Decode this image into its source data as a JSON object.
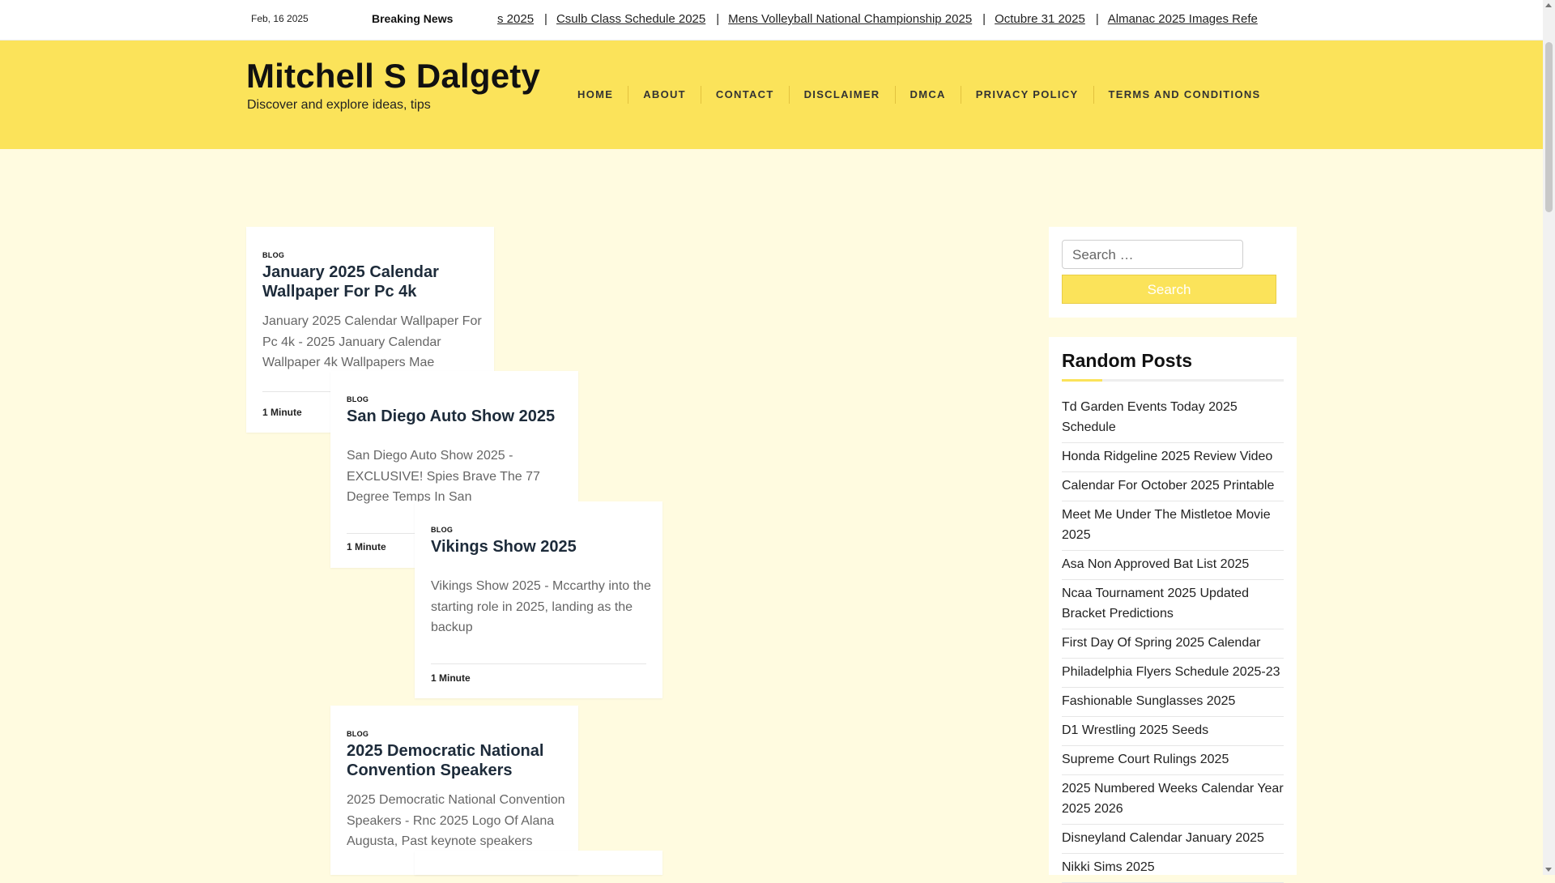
{
  "topbar": {
    "date": "Feb, 16 2025",
    "breaking_label": "Breaking News",
    "ticker": [
      "s 2025",
      "Csulb Class Schedule 2025",
      "Mens Volleyball National Championship 2025",
      "Octubre 31 2025",
      "Almanac 2025 Images Refe"
    ]
  },
  "header": {
    "site_title": "Mitchell S Dalgety",
    "tagline": "Discover and explore ideas, tips",
    "nav": [
      "HOME",
      "ABOUT",
      "CONTACT",
      "DISCLAIMER",
      "DMCA",
      "PRIVACY POLICY",
      "TERMS AND CONDITIONS"
    ]
  },
  "posts": [
    {
      "category": "BLOG",
      "title": "January 2025 Calendar Wallpaper For Pc 4k",
      "excerpt": "January 2025 Calendar Wallpaper For Pc 4k - 2025 January Calendar Wallpaper 4k Wallpapers Mae",
      "read_time": "1 Minute"
    },
    {
      "category": "BLOG",
      "title": "San Diego Auto Show 2025",
      "excerpt": "San Diego Auto Show 2025 - EXCLUSIVE! Spies Brave The 77 Degree Temps In San",
      "read_time": "1 Minute"
    },
    {
      "category": "BLOG",
      "title": "Vikings Show 2025",
      "excerpt": "Vikings Show 2025 - Mccarthy into the starting role in 2025, landing as the backup",
      "read_time": "1 Minute"
    },
    {
      "category": "BLOG",
      "title": "2025 Democratic National Convention Speakers",
      "excerpt": "2025 Democratic National Convention Speakers - Rnc 2025 Logo Of Alana Augusta, Past keynote speakers",
      "read_time": ""
    }
  ],
  "sidebar": {
    "search": {
      "placeholder": "Search …",
      "button_label": "Search"
    },
    "random_posts": {
      "title": "Random Posts",
      "items": [
        "Td Garden Events Today 2025 Schedule",
        "Honda Ridgeline 2025 Review Video",
        "Calendar For October 2025 Printable",
        "Meet Me Under The Mistletoe Movie 2025",
        "Asa Non Approved Bat List 2025",
        "Ncaa Tournament 2025 Updated Bracket Predictions",
        "First Day Of Spring 2025 Calendar",
        "Philadelphia Flyers Schedule 2025-23",
        "Fashionable Sunglasses 2025",
        "D1 Wrestling 2025 Seeds",
        "Supreme Court Rulings 2025",
        "2025 Numbered Weeks Calendar Year 2025 2026",
        "Disneyland Calendar January 2025",
        "Nikki Sims 2025"
      ]
    }
  },
  "colors": {
    "accent": "#fbe35a",
    "page_background": "#fffbe0"
  }
}
